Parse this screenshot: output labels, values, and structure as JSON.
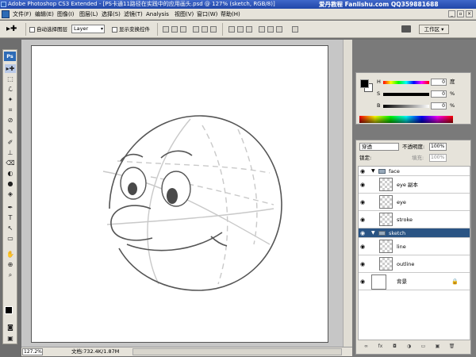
{
  "window": {
    "title": "Adobe Photoshop CS3 Extended - [PS卡通11路径在实践中的应用画头.psd @ 127% (sketch, RGB/8)]",
    "watermark": "爱丹教程 Fanlishu.com QQ359881688"
  },
  "menu": {
    "items": [
      "文件(F)",
      "编辑(E)",
      "图像(I)",
      "图层(L)",
      "选择(S)",
      "滤镜(T)",
      "Analysis",
      "视图(V)",
      "窗口(W)",
      "帮助(H)"
    ]
  },
  "options": {
    "auto_select_label": "自动选择图层",
    "auto_select_value": "Layer",
    "show_transform_label": "显示变换控件",
    "workspace_label": "工作区 ▾"
  },
  "toolbox": {
    "logo": "Ps",
    "tools": [
      "▸✚",
      "⬚",
      "ℒ",
      "✦",
      "⌗",
      "⊘",
      "✎",
      "✐",
      "⊥",
      "⌫",
      "◐",
      "●",
      "◈",
      "✒",
      "T",
      "↖",
      "▭",
      "✋",
      "⊕",
      "⌕"
    ]
  },
  "document": {
    "zoom": "127.2%",
    "info": "文档:732.4K/1.87M"
  },
  "color_panel": {
    "channels": [
      {
        "name": "H",
        "value": "0",
        "unit": "度"
      },
      {
        "name": "S",
        "value": "0",
        "unit": "%"
      },
      {
        "name": "B",
        "value": "0",
        "unit": "%"
      }
    ],
    "foreground": "#000000",
    "background": "#ffffff"
  },
  "layers_panel": {
    "blend_mode": "穿透",
    "opacity_label": "不透明度:",
    "opacity_value": "100%",
    "lock_label": "锁定:",
    "fill_label": "填充:",
    "fill_value": "100%",
    "layers": [
      {
        "name": "face",
        "type": "group",
        "selected": false
      },
      {
        "name": "eye 副本",
        "type": "layer",
        "selected": false
      },
      {
        "name": "eye",
        "type": "layer",
        "selected": false
      },
      {
        "name": "stroke",
        "type": "layer",
        "selected": false
      },
      {
        "name": "sketch",
        "type": "group",
        "selected": true
      },
      {
        "name": "line",
        "type": "layer",
        "selected": false
      },
      {
        "name": "outline",
        "type": "layer",
        "selected": false
      },
      {
        "name": "背景",
        "type": "background",
        "selected": false
      }
    ]
  }
}
